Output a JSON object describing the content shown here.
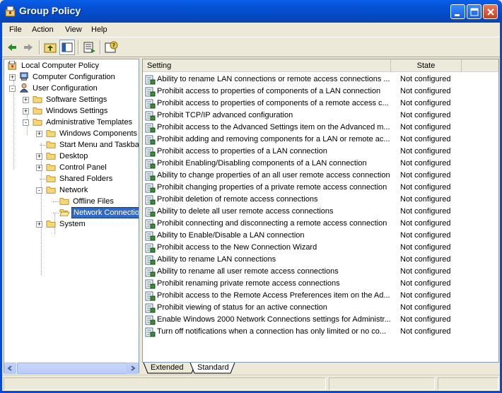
{
  "window": {
    "title": "Group Policy"
  },
  "menu": {
    "items": [
      "File",
      "Action",
      "View",
      "Help"
    ]
  },
  "tree": {
    "items": [
      {
        "label": "Local Computer Policy"
      },
      {
        "label": "Computer Configuration"
      },
      {
        "label": "User Configuration"
      },
      {
        "label": "Software Settings"
      },
      {
        "label": "Windows Settings"
      },
      {
        "label": "Administrative Templates"
      },
      {
        "label": "Windows Components"
      },
      {
        "label": "Start Menu and Taskbar"
      },
      {
        "label": "Desktop"
      },
      {
        "label": "Control Panel"
      },
      {
        "label": "Shared Folders"
      },
      {
        "label": "Network"
      },
      {
        "label": "Offline Files"
      },
      {
        "label": "Network Connections"
      },
      {
        "label": "System"
      }
    ]
  },
  "list": {
    "columns": {
      "setting": "Setting",
      "state": "State"
    },
    "rows": [
      {
        "setting": "Ability to rename LAN connections or remote access connections ...",
        "state": "Not configured"
      },
      {
        "setting": "Prohibit access to properties of components of a LAN connection",
        "state": "Not configured"
      },
      {
        "setting": "Prohibit access to properties of components of a remote access c...",
        "state": "Not configured"
      },
      {
        "setting": "Prohibit TCP/IP advanced configuration",
        "state": "Not configured"
      },
      {
        "setting": "Prohibit access to the Advanced Settings item on the Advanced m...",
        "state": "Not configured"
      },
      {
        "setting": "Prohibit adding and removing components for a LAN or remote ac...",
        "state": "Not configured"
      },
      {
        "setting": "Prohibit access to properties of a LAN connection",
        "state": "Not configured"
      },
      {
        "setting": "Prohibit Enabling/Disabling components of a LAN connection",
        "state": "Not configured"
      },
      {
        "setting": "Ability to change properties of an all user remote access connection",
        "state": "Not configured"
      },
      {
        "setting": "Prohibit changing properties of a private remote access connection",
        "state": "Not configured"
      },
      {
        "setting": "Prohibit deletion of remote access connections",
        "state": "Not configured"
      },
      {
        "setting": "Ability to delete all user remote access connections",
        "state": "Not configured"
      },
      {
        "setting": "Prohibit connecting and disconnecting a remote access connection",
        "state": "Not configured"
      },
      {
        "setting": "Ability to Enable/Disable a LAN connection",
        "state": "Not configured"
      },
      {
        "setting": "Prohibit access to the New Connection Wizard",
        "state": "Not configured"
      },
      {
        "setting": "Ability to rename LAN connections",
        "state": "Not configured"
      },
      {
        "setting": "Ability to rename all user remote access connections",
        "state": "Not configured"
      },
      {
        "setting": "Prohibit renaming private remote access connections",
        "state": "Not configured"
      },
      {
        "setting": "Prohibit access to the Remote Access Preferences item on the Ad...",
        "state": "Not configured"
      },
      {
        "setting": "Prohibit viewing of status for an active connection",
        "state": "Not configured"
      },
      {
        "setting": "Enable Windows 2000 Network Connections settings for Administr...",
        "state": "Not configured"
      },
      {
        "setting": "Turn off notifications when a connection has only limited or no co...",
        "state": "Not configured"
      }
    ]
  },
  "tabs": [
    "Extended",
    "Standard"
  ],
  "colors": {
    "titlebar": "#0553d8",
    "selection": "#316ac5",
    "window_bg": "#ece9d8"
  }
}
